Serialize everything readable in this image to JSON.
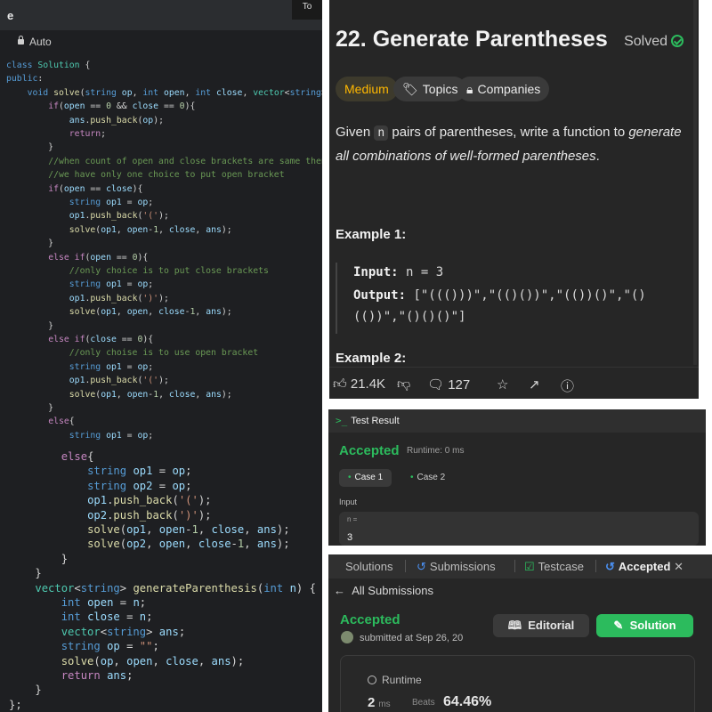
{
  "editor": {
    "title_left": "e",
    "title_right": "To",
    "mode": "Auto",
    "top_lines": [
      [
        [
          "kw",
          "class "
        ],
        [
          "ty",
          "Solution "
        ],
        [
          "tx",
          "{"
        ]
      ],
      [
        [
          "kw",
          "public"
        ],
        [
          "tx",
          ":"
        ]
      ],
      [
        [
          "tx",
          "    "
        ],
        [
          "kw",
          "void "
        ],
        [
          "fn",
          "solve"
        ],
        [
          "tx",
          "("
        ],
        [
          "kw",
          "string "
        ],
        [
          "vr",
          "op"
        ],
        [
          "tx",
          ", "
        ],
        [
          "kw",
          "int "
        ],
        [
          "vr",
          "open"
        ],
        [
          "tx",
          ", "
        ],
        [
          "kw",
          "int "
        ],
        [
          "vr",
          "close"
        ],
        [
          "tx",
          ", "
        ],
        [
          "ty",
          "vector"
        ],
        [
          "tx",
          "<"
        ],
        [
          "kw",
          "string"
        ],
        [
          "tx",
          "> &"
        ],
        [
          "vr",
          "ans"
        ],
        [
          "tx",
          ")"
        ]
      ],
      [
        [
          "tx",
          "        "
        ],
        [
          "ctl",
          "if"
        ],
        [
          "tx",
          "("
        ],
        [
          "vr",
          "open"
        ],
        [
          "tx",
          " == "
        ],
        [
          "nm",
          "0"
        ],
        [
          "tx",
          " && "
        ],
        [
          "vr",
          "close"
        ],
        [
          "tx",
          " == "
        ],
        [
          "nm",
          "0"
        ],
        [
          "tx",
          "){"
        ]
      ],
      [
        [
          "tx",
          "            "
        ],
        [
          "vr",
          "ans"
        ],
        [
          "tx",
          "."
        ],
        [
          "fn",
          "push_back"
        ],
        [
          "tx",
          "("
        ],
        [
          "vr",
          "op"
        ],
        [
          "tx",
          ");"
        ]
      ],
      [
        [
          "tx",
          "            "
        ],
        [
          "ctl",
          "return"
        ],
        [
          "tx",
          ";"
        ]
      ],
      [
        [
          "tx",
          "        }"
        ]
      ],
      [
        [
          "tx",
          "        "
        ],
        [
          "cm",
          "//when count of open and close brackets are same then"
        ]
      ],
      [
        [
          "tx",
          "        "
        ],
        [
          "cm",
          "//we have only one choice to put open bracket"
        ]
      ],
      [
        [
          "tx",
          "        "
        ],
        [
          "ctl",
          "if"
        ],
        [
          "tx",
          "("
        ],
        [
          "vr",
          "open"
        ],
        [
          "tx",
          " == "
        ],
        [
          "vr",
          "close"
        ],
        [
          "tx",
          "){"
        ]
      ],
      [
        [
          "tx",
          "            "
        ],
        [
          "kw",
          "string "
        ],
        [
          "vr",
          "op1"
        ],
        [
          "tx",
          " = "
        ],
        [
          "vr",
          "op"
        ],
        [
          "tx",
          ";"
        ]
      ],
      [
        [
          "tx",
          "            "
        ],
        [
          "vr",
          "op1"
        ],
        [
          "tx",
          "."
        ],
        [
          "fn",
          "push_back"
        ],
        [
          "tx",
          "("
        ],
        [
          "st",
          "'('"
        ],
        [
          "tx",
          ");"
        ]
      ],
      [
        [
          "tx",
          "            "
        ],
        [
          "fn",
          "solve"
        ],
        [
          "tx",
          "("
        ],
        [
          "vr",
          "op1"
        ],
        [
          "tx",
          ", "
        ],
        [
          "vr",
          "open"
        ],
        [
          "tx",
          "-"
        ],
        [
          "nm",
          "1"
        ],
        [
          "tx",
          ", "
        ],
        [
          "vr",
          "close"
        ],
        [
          "tx",
          ", "
        ],
        [
          "vr",
          "ans"
        ],
        [
          "tx",
          ");"
        ]
      ],
      [
        [
          "tx",
          "        }"
        ]
      ],
      [
        [
          "tx",
          "        "
        ],
        [
          "ctl",
          "else if"
        ],
        [
          "tx",
          "("
        ],
        [
          "vr",
          "open"
        ],
        [
          "tx",
          " == "
        ],
        [
          "nm",
          "0"
        ],
        [
          "tx",
          "){"
        ]
      ],
      [
        [
          "tx",
          "            "
        ],
        [
          "cm",
          "//only choice is to put close brackets"
        ]
      ],
      [
        [
          "tx",
          "            "
        ],
        [
          "kw",
          "string "
        ],
        [
          "vr",
          "op1"
        ],
        [
          "tx",
          " = "
        ],
        [
          "vr",
          "op"
        ],
        [
          "tx",
          ";"
        ]
      ],
      [
        [
          "tx",
          "            "
        ],
        [
          "vr",
          "op1"
        ],
        [
          "tx",
          "."
        ],
        [
          "fn",
          "push_back"
        ],
        [
          "tx",
          "("
        ],
        [
          "st",
          "')'"
        ],
        [
          "tx",
          ");"
        ]
      ],
      [
        [
          "tx",
          "            "
        ],
        [
          "fn",
          "solve"
        ],
        [
          "tx",
          "("
        ],
        [
          "vr",
          "op1"
        ],
        [
          "tx",
          ", "
        ],
        [
          "vr",
          "open"
        ],
        [
          "tx",
          ", "
        ],
        [
          "vr",
          "close"
        ],
        [
          "tx",
          "-"
        ],
        [
          "nm",
          "1"
        ],
        [
          "tx",
          ", "
        ],
        [
          "vr",
          "ans"
        ],
        [
          "tx",
          ");"
        ]
      ],
      [
        [
          "tx",
          "        }"
        ]
      ],
      [
        [
          "tx",
          "        "
        ],
        [
          "ctl",
          "else if"
        ],
        [
          "tx",
          "("
        ],
        [
          "vr",
          "close"
        ],
        [
          "tx",
          " == "
        ],
        [
          "nm",
          "0"
        ],
        [
          "tx",
          "){"
        ]
      ],
      [
        [
          "tx",
          "            "
        ],
        [
          "cm",
          "//only choise is to use open bracket"
        ]
      ],
      [
        [
          "tx",
          "            "
        ],
        [
          "kw",
          "string "
        ],
        [
          "vr",
          "op1"
        ],
        [
          "tx",
          " = "
        ],
        [
          "vr",
          "op"
        ],
        [
          "tx",
          ";"
        ]
      ],
      [
        [
          "tx",
          "            "
        ],
        [
          "vr",
          "op1"
        ],
        [
          "tx",
          "."
        ],
        [
          "fn",
          "push_back"
        ],
        [
          "tx",
          "("
        ],
        [
          "st",
          "'('"
        ],
        [
          "tx",
          ");"
        ]
      ],
      [
        [
          "tx",
          "            "
        ],
        [
          "fn",
          "solve"
        ],
        [
          "tx",
          "("
        ],
        [
          "vr",
          "op1"
        ],
        [
          "tx",
          ", "
        ],
        [
          "vr",
          "open"
        ],
        [
          "tx",
          "-"
        ],
        [
          "nm",
          "1"
        ],
        [
          "tx",
          ", "
        ],
        [
          "vr",
          "close"
        ],
        [
          "tx",
          ", "
        ],
        [
          "vr",
          "ans"
        ],
        [
          "tx",
          ");"
        ]
      ],
      [
        [
          "tx",
          "        }"
        ]
      ],
      [
        [
          "tx",
          "        "
        ],
        [
          "ctl",
          "else"
        ],
        [
          "tx",
          "{"
        ]
      ],
      [
        [
          "tx",
          "            "
        ],
        [
          "kw",
          "string "
        ],
        [
          "vr",
          "op1"
        ],
        [
          "tx",
          " = "
        ],
        [
          "vr",
          "op"
        ],
        [
          "tx",
          ";"
        ]
      ]
    ],
    "bottom_lines": [
      [
        [
          "tx",
          "        "
        ],
        [
          "ctl",
          "else"
        ],
        [
          "tx",
          "{"
        ]
      ],
      [
        [
          "tx",
          "            "
        ],
        [
          "kw",
          "string "
        ],
        [
          "vr",
          "op1"
        ],
        [
          "tx",
          " = "
        ],
        [
          "vr",
          "op"
        ],
        [
          "tx",
          ";"
        ]
      ],
      [
        [
          "tx",
          "            "
        ],
        [
          "kw",
          "string "
        ],
        [
          "vr",
          "op2"
        ],
        [
          "tx",
          " = "
        ],
        [
          "vr",
          "op"
        ],
        [
          "tx",
          ";"
        ]
      ],
      [
        [
          "tx",
          "            "
        ],
        [
          "vr",
          "op1"
        ],
        [
          "tx",
          "."
        ],
        [
          "fn",
          "push_back"
        ],
        [
          "tx",
          "("
        ],
        [
          "st",
          "'('"
        ],
        [
          "tx",
          ");"
        ]
      ],
      [
        [
          "tx",
          "            "
        ],
        [
          "vr",
          "op2"
        ],
        [
          "tx",
          "."
        ],
        [
          "fn",
          "push_back"
        ],
        [
          "tx",
          "("
        ],
        [
          "st",
          "')'"
        ],
        [
          "tx",
          ");"
        ]
      ],
      [
        [
          "tx",
          "            "
        ],
        [
          "fn",
          "solve"
        ],
        [
          "tx",
          "("
        ],
        [
          "vr",
          "op1"
        ],
        [
          "tx",
          ", "
        ],
        [
          "vr",
          "open"
        ],
        [
          "tx",
          "-"
        ],
        [
          "nm",
          "1"
        ],
        [
          "tx",
          ", "
        ],
        [
          "vr",
          "close"
        ],
        [
          "tx",
          ", "
        ],
        [
          "vr",
          "ans"
        ],
        [
          "tx",
          ");"
        ]
      ],
      [
        [
          "tx",
          "            "
        ],
        [
          "fn",
          "solve"
        ],
        [
          "tx",
          "("
        ],
        [
          "vr",
          "op2"
        ],
        [
          "tx",
          ", "
        ],
        [
          "vr",
          "open"
        ],
        [
          "tx",
          ", "
        ],
        [
          "vr",
          "close"
        ],
        [
          "tx",
          "-"
        ],
        [
          "nm",
          "1"
        ],
        [
          "tx",
          ", "
        ],
        [
          "vr",
          "ans"
        ],
        [
          "tx",
          ");"
        ]
      ],
      [
        [
          "tx",
          "        }"
        ]
      ],
      [
        [
          "tx",
          "    }"
        ]
      ],
      [
        [
          "tx",
          "    "
        ],
        [
          "ty",
          "vector"
        ],
        [
          "tx",
          "<"
        ],
        [
          "kw",
          "string"
        ],
        [
          "tx",
          "> "
        ],
        [
          "fn",
          "generateParenthesis"
        ],
        [
          "tx",
          "("
        ],
        [
          "kw",
          "int "
        ],
        [
          "vr",
          "n"
        ],
        [
          "tx",
          ") {"
        ]
      ],
      [
        [
          "tx",
          "        "
        ],
        [
          "kw",
          "int "
        ],
        [
          "vr",
          "open"
        ],
        [
          "tx",
          " = "
        ],
        [
          "vr",
          "n"
        ],
        [
          "tx",
          ";"
        ]
      ],
      [
        [
          "tx",
          "        "
        ],
        [
          "kw",
          "int "
        ],
        [
          "vr",
          "close"
        ],
        [
          "tx",
          " = "
        ],
        [
          "vr",
          "n"
        ],
        [
          "tx",
          ";"
        ]
      ],
      [
        [
          "tx",
          "        "
        ],
        [
          "ty",
          "vector"
        ],
        [
          "tx",
          "<"
        ],
        [
          "kw",
          "string"
        ],
        [
          "tx",
          "> "
        ],
        [
          "vr",
          "ans"
        ],
        [
          "tx",
          ";"
        ]
      ],
      [
        [
          "tx",
          "        "
        ],
        [
          "kw",
          "string "
        ],
        [
          "vr",
          "op"
        ],
        [
          "tx",
          " = "
        ],
        [
          "st",
          "\"\""
        ],
        [
          "tx",
          ";"
        ]
      ],
      [
        [
          "tx",
          "        "
        ],
        [
          "fn",
          "solve"
        ],
        [
          "tx",
          "("
        ],
        [
          "vr",
          "op"
        ],
        [
          "tx",
          ", "
        ],
        [
          "vr",
          "open"
        ],
        [
          "tx",
          ", "
        ],
        [
          "vr",
          "close"
        ],
        [
          "tx",
          ", "
        ],
        [
          "vr",
          "ans"
        ],
        [
          "tx",
          ");"
        ]
      ],
      [
        [
          "tx",
          "        "
        ],
        [
          "ctl",
          "return "
        ],
        [
          "vr",
          "ans"
        ],
        [
          "tx",
          ";"
        ]
      ],
      [
        [
          "tx",
          "    }"
        ]
      ],
      [
        [
          "tx",
          "};"
        ]
      ]
    ]
  },
  "problem": {
    "title": "22. Generate Parentheses",
    "status": "Solved",
    "difficulty": "Medium",
    "topics": "Topics",
    "companies": "Companies",
    "desc_pre": "Given ",
    "desc_code": "n",
    "desc_mid": " pairs of parentheses, write a function to ",
    "desc_em": "generate all combinations of well-formed parentheses",
    "desc_end": ".",
    "example1": "Example 1:",
    "input_label": "Input:",
    "input_value": " n = 3",
    "output_label": "Output:",
    "output_value_1": " [\"((()))\",\"(()())\",\"(())()\",\"()",
    "output_value_2": "(())\",\"()()()\"]",
    "example2": "Example 2:",
    "likes": "21.4K",
    "comments": "127"
  },
  "test": {
    "header": "Test Result",
    "status": "Accepted",
    "runtime": "Runtime: 0 ms",
    "case1": "Case 1",
    "case2": "Case 2",
    "input_label": "Input",
    "var_name": "n =",
    "var_value": "3"
  },
  "submissions": {
    "tab_solutions": "Solutions",
    "tab_submissions": "Submissions",
    "tab_testcase": "Testcase",
    "tab_accepted": "Accepted",
    "back": "All Submissions",
    "status": "Accepted",
    "submitted": "submitted at Sep 26, 20",
    "editorial": "Editorial",
    "solution": "Solution",
    "runtime_label": "Runtime",
    "runtime_value": "2",
    "runtime_unit": "ms",
    "beats_label": "Beats",
    "beats_value": "64.46%"
  },
  "colors": {
    "accent_green": "#2cbb5d",
    "medium": "#ffb800",
    "editor_bg": "#1e1f22",
    "panel_bg": "#262626"
  }
}
